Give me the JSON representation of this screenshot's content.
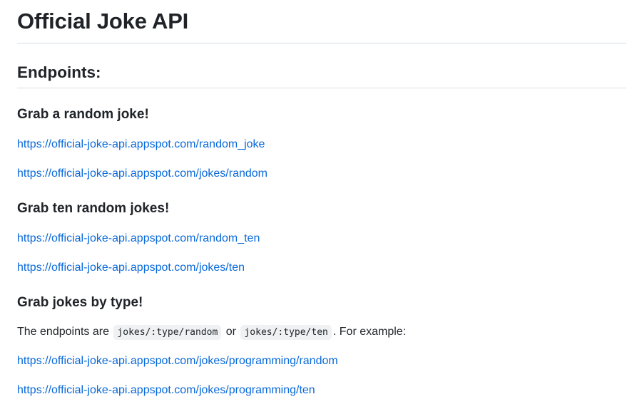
{
  "page_title": "Official Joke API",
  "endpoints_heading": "Endpoints:",
  "sections": [
    {
      "heading": "Grab a random joke!",
      "links": [
        "https://official-joke-api.appspot.com/random_joke",
        "https://official-joke-api.appspot.com/jokes/random"
      ]
    },
    {
      "heading": "Grab ten random jokes!",
      "links": [
        "https://official-joke-api.appspot.com/random_ten",
        "https://official-joke-api.appspot.com/jokes/ten"
      ]
    },
    {
      "heading": "Grab jokes by type!",
      "description": {
        "prefix": "The endpoints are",
        "code1": "jokes/:type/random",
        "connector": "or",
        "code2": "jokes/:type/ten",
        "suffix": ". For example:"
      },
      "links": [
        "https://official-joke-api.appspot.com/jokes/programming/random",
        "https://official-joke-api.appspot.com/jokes/programming/ten"
      ]
    }
  ]
}
